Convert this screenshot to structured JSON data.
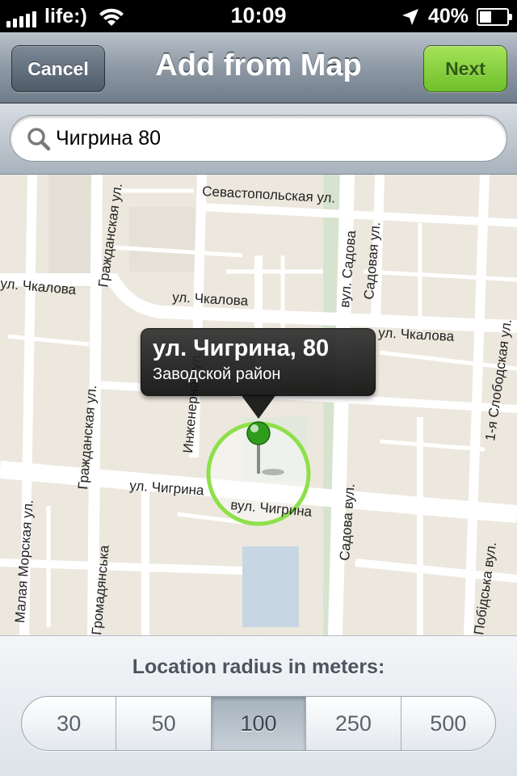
{
  "status_bar": {
    "carrier": "life:)",
    "time": "10:09",
    "battery_percent": "40%",
    "battery_level": 0.4,
    "signal_bars": 5,
    "icons": [
      "signal-bars-icon",
      "wifi-icon",
      "location-arrow-icon",
      "battery-icon"
    ]
  },
  "nav_bar": {
    "title": "Add from Map",
    "cancel_label": "Cancel",
    "next_label": "Next",
    "next_color": "#7ccb34"
  },
  "search": {
    "value": "Чигрина 80",
    "icon": "search-icon"
  },
  "map": {
    "street_labels": [
      "Севастопольская ул.",
      "Гражданская ул.",
      "ул. Чкалова",
      "ул. Чкалова",
      "ул. Чкалова",
      "вул. Садова",
      "Садовая ул.",
      "1-я Слободская ул.",
      "Гражданская ул.",
      "Инженерная ул.",
      "ул. Чигрина",
      "вул. Чигрина",
      "Малая Морская ул.",
      "Садова вул.",
      "Громадянська",
      "Побідська вул."
    ],
    "callout": {
      "title": "ул. Чигрина, 80",
      "subtitle": "Заводской район"
    },
    "pin_color": "#2e9c1d",
    "radius_circle_color": "#8ee04a"
  },
  "radius": {
    "label": "Location radius in meters:",
    "options": [
      "30",
      "50",
      "100",
      "250",
      "500"
    ],
    "selected": "100"
  }
}
